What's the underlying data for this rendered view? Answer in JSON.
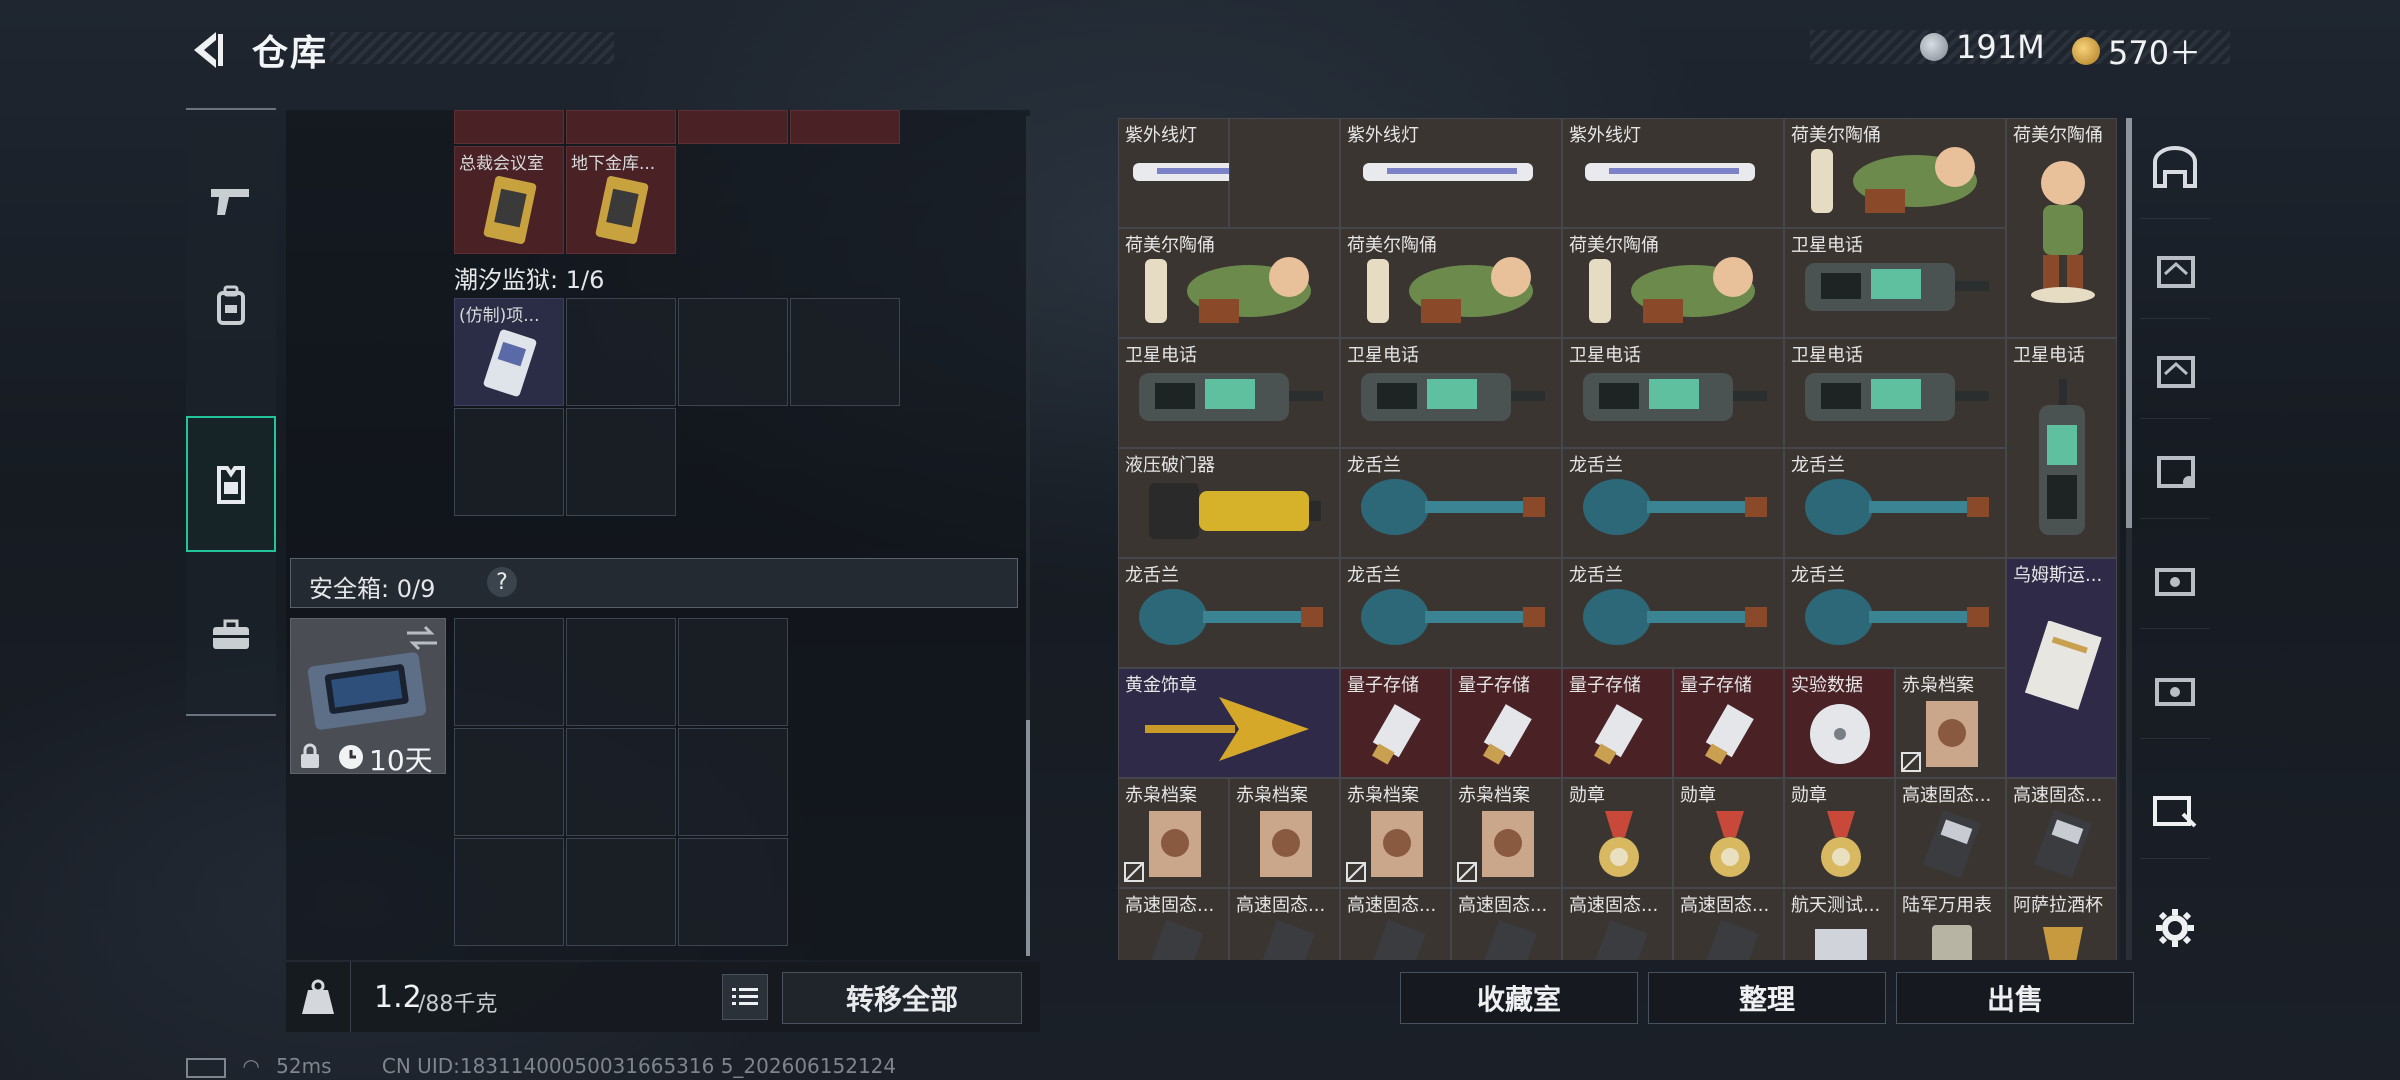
{
  "header": {
    "title": "仓库"
  },
  "currency": {
    "coins": "191M",
    "premium": "570＋"
  },
  "colors": {
    "accent": "#23c49b",
    "rare_red": "#4a2226",
    "rare_purple": "#2e2a48",
    "common": "#3b3532"
  },
  "left_nav": {
    "items": [
      "pistol-icon",
      "backpack-icon",
      "vest-icon",
      "briefcase-icon"
    ],
    "active": 2
  },
  "container": {
    "top_labels": [
      "总裁会议室",
      "地下金库..."
    ],
    "prison_label": "潮汐监狱: 1/6",
    "prison_item": "(仿制)项..."
  },
  "safebox": {
    "label": "安全箱: 0/9",
    "help": "?",
    "timer": "10天"
  },
  "weight": {
    "current": "1.2",
    "max": "/88千克"
  },
  "transfer_button": "转移全部",
  "items": [
    [
      "紫外线灯",
      "紫外线灯",
      "紫外线灯",
      "荷美尔陶俑",
      "荷美尔陶俑"
    ],
    [
      "荷美尔陶俑",
      "荷美尔陶俑",
      "荷美尔陶俑",
      "卫星电话"
    ],
    [
      "卫星电话",
      "卫星电话",
      "卫星电话",
      "卫星电话",
      "卫星电话"
    ],
    [
      "液压破门器",
      "龙舌兰",
      "龙舌兰",
      "龙舌兰"
    ],
    [
      "龙舌兰",
      "龙舌兰",
      "龙舌兰",
      "龙舌兰",
      "乌姆斯运..."
    ],
    [
      "黄金饰章",
      "量子存储",
      "量子存储",
      "量子存储",
      "量子存储",
      "实验数据",
      "赤枭档案"
    ],
    [
      "赤枭档案",
      "赤枭档案",
      "赤枭档案",
      "赤枭档案",
      "勋章",
      "勋章",
      "勋章",
      "高速固态...",
      "高速固态..."
    ],
    [
      "高速固态...",
      "高速固态...",
      "高速固态...",
      "高速固态...",
      "高速固态...",
      "高速固态...",
      "航天测试...",
      "陆军万用表",
      "阿萨拉酒杯"
    ]
  ],
  "bottom_buttons": {
    "collection": "收藏室",
    "sort": "整理",
    "sell": "出售"
  },
  "status_bar": {
    "ping": "52ms",
    "uid": "CN UID:18311400050031665316 5_202606152124"
  }
}
